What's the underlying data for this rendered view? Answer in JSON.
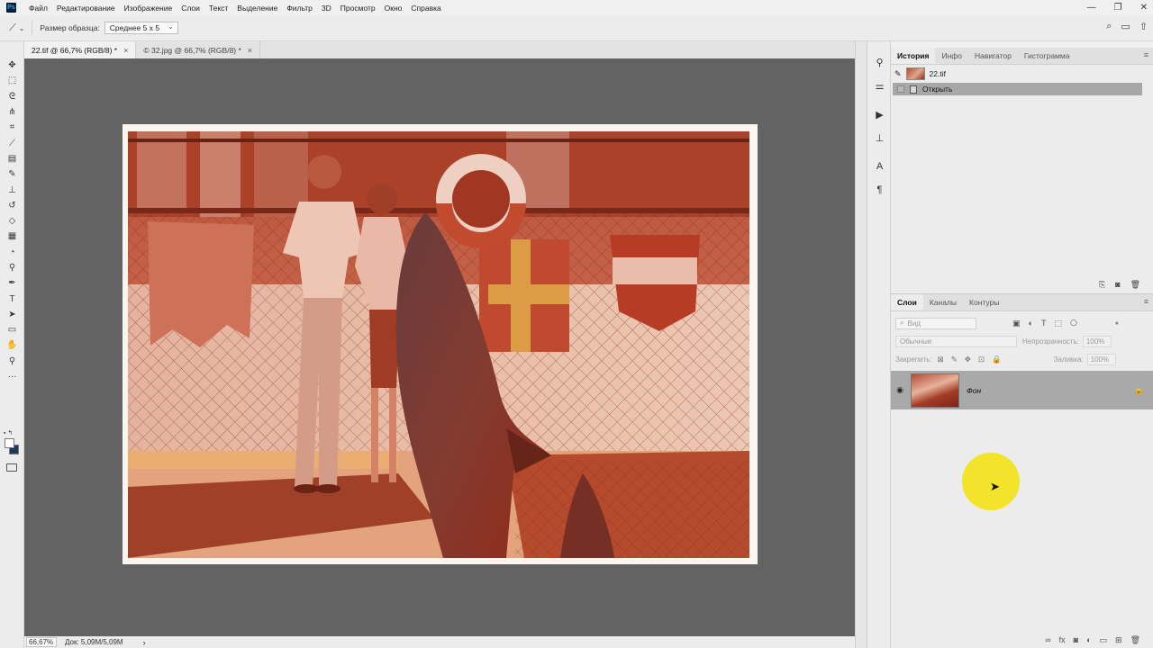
{
  "menubar": {
    "logo": "Ps",
    "items": [
      "Файл",
      "Редактирование",
      "Изображение",
      "Слои",
      "Текст",
      "Выделение",
      "Фильтр",
      "3D",
      "Просмотр",
      "Окно",
      "Справка"
    ],
    "window_controls": [
      "—",
      "❐",
      "✕"
    ]
  },
  "options": {
    "tool_icon": "eyedropper-icon",
    "sample_label": "Размер образца:",
    "sample_value": "Среднее 5 х 5"
  },
  "tabs": [
    {
      "title": "22.tif @ 66,7% (RGB/8) *",
      "close": "×",
      "active": true
    },
    {
      "title": "© 32.jpg @ 66,7% (RGB/8) *",
      "close": "×",
      "active": false
    }
  ],
  "status": {
    "zoom": "66,67%",
    "doc": "Док: 5,09M/5,09M",
    "arrow": "›"
  },
  "history": {
    "tabs": [
      "История",
      "Инфо",
      "Навигатор",
      "Гистограмма"
    ],
    "snapshot": "22.tif",
    "steps": [
      "Открыть"
    ]
  },
  "layers": {
    "tabs": [
      "Слои",
      "Каналы",
      "Контуры"
    ],
    "filter_placeholder": "Вид",
    "blend_mode": "Обычные",
    "opacity_label": "Непрозрачность:",
    "opacity_value": "100%",
    "lock_label": "Закрепить:",
    "fill_label": "Заливка:",
    "fill_value": "100%",
    "items": [
      {
        "name": "Фон",
        "visible": true,
        "locked": true
      }
    ]
  },
  "colors": {
    "canvas": "#636363",
    "highlight": "#f3e21a"
  }
}
